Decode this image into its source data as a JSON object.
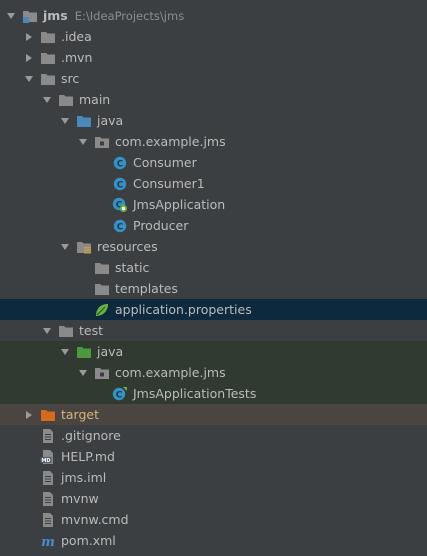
{
  "project_tree": {
    "rows": [
      {
        "label": "jms",
        "path": "E:\\IdeaProjects\\jms",
        "level": 0,
        "arrow": "down",
        "icon": "module-folder-icon",
        "bold": true
      },
      {
        "label": ".idea",
        "level": 1,
        "arrow": "right",
        "icon": "folder-icon"
      },
      {
        "label": ".mvn",
        "level": 1,
        "arrow": "right",
        "icon": "folder-icon"
      },
      {
        "label": "src",
        "level": 1,
        "arrow": "down",
        "icon": "folder-icon"
      },
      {
        "label": "main",
        "level": 2,
        "arrow": "down",
        "icon": "folder-icon"
      },
      {
        "label": "java",
        "level": 3,
        "arrow": "down",
        "icon": "source-root-folder-icon"
      },
      {
        "label": "com.example.jms",
        "level": 4,
        "arrow": "down",
        "icon": "package-icon"
      },
      {
        "label": "Consumer",
        "level": 5,
        "arrow": "none",
        "icon": "java-class-icon"
      },
      {
        "label": "Consumer1",
        "level": 5,
        "arrow": "none",
        "icon": "java-class-icon"
      },
      {
        "label": "JmsApplication",
        "level": 5,
        "arrow": "none",
        "icon": "spring-boot-class-icon"
      },
      {
        "label": "Producer",
        "level": 5,
        "arrow": "none",
        "icon": "java-class-icon"
      },
      {
        "label": "resources",
        "level": 3,
        "arrow": "down",
        "icon": "resources-folder-icon"
      },
      {
        "label": "static",
        "level": 4,
        "arrow": "none",
        "icon": "folder-icon"
      },
      {
        "label": "templates",
        "level": 4,
        "arrow": "none",
        "icon": "folder-icon"
      },
      {
        "label": "application.properties",
        "level": 4,
        "arrow": "none",
        "icon": "spring-leaf-icon",
        "selected": true
      },
      {
        "label": "test",
        "level": 2,
        "arrow": "down",
        "icon": "folder-icon"
      },
      {
        "label": "java",
        "level": 3,
        "arrow": "down",
        "icon": "test-root-folder-icon",
        "test": true
      },
      {
        "label": "com.example.jms",
        "level": 4,
        "arrow": "down",
        "icon": "package-icon",
        "test": true
      },
      {
        "label": "JmsApplicationTests",
        "level": 5,
        "arrow": "none",
        "icon": "test-class-icon",
        "test": true
      },
      {
        "label": "target",
        "level": 1,
        "arrow": "right",
        "icon": "excluded-folder-icon",
        "excluded": true
      },
      {
        "label": ".gitignore",
        "level": 1,
        "arrow": "none",
        "icon": "text-file-icon"
      },
      {
        "label": "HELP.md",
        "level": 1,
        "arrow": "none",
        "icon": "markdown-file-icon"
      },
      {
        "label": "jms.iml",
        "level": 1,
        "arrow": "none",
        "icon": "iml-file-icon"
      },
      {
        "label": "mvnw",
        "level": 1,
        "arrow": "none",
        "icon": "text-file-icon"
      },
      {
        "label": "mvnw.cmd",
        "level": 1,
        "arrow": "none",
        "icon": "text-file-icon"
      },
      {
        "label": "pom.xml",
        "level": 1,
        "arrow": "none",
        "icon": "maven-icon"
      }
    ]
  },
  "colors": {
    "panel_background": "#3c3f41",
    "selected_row": "#0d293e",
    "test_row": "#313a31",
    "excluded_row": "#4a4540",
    "text": "#bbbbbb",
    "path_text": "#8c8c8c",
    "folder": "#8a8a8a",
    "source_folder": "#4a8ab8",
    "test_folder": "#4b9b3e",
    "excluded_folder": "#d36a1e",
    "class_icon": "#3592c4",
    "spring": "#6db33f"
  }
}
